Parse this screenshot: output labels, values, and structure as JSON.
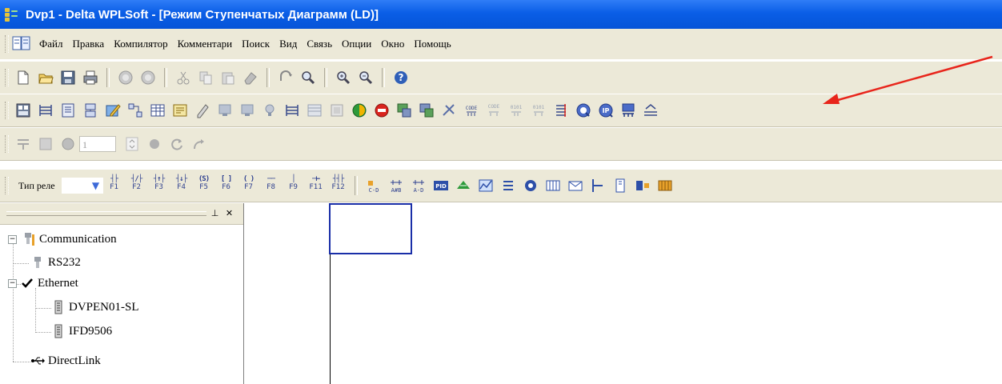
{
  "window": {
    "title": "Dvp1 - Delta WPLSoft - [Режим Ступенчатых Диаграмм (LD)]"
  },
  "menu": {
    "items": [
      "Файл",
      "Правка",
      "Компилятор",
      "Комментари",
      "Поиск",
      "Вид",
      "Связь",
      "Опции",
      "Окно",
      "Помощь"
    ]
  },
  "toolbar_input": {
    "relay_type_label": "Тип реле",
    "step_value": "1"
  },
  "function_keys": [
    {
      "icon": "contact-no-icon",
      "key": "F1"
    },
    {
      "icon": "contact-nc-icon",
      "key": "F2"
    },
    {
      "icon": "contact-rising-icon",
      "key": "F3"
    },
    {
      "icon": "contact-falling-icon",
      "key": "F4"
    },
    {
      "icon": "coil-set-icon",
      "key": "F5"
    },
    {
      "icon": "application-instruction-icon",
      "key": "F6"
    },
    {
      "icon": "output-coil-icon",
      "key": "F7"
    },
    {
      "icon": "horizontal-line-icon",
      "key": "F8"
    },
    {
      "icon": "vertical-line-icon",
      "key": "F9"
    },
    {
      "icon": "invert-icon",
      "key": "F11"
    },
    {
      "icon": "parallel-branch-icon",
      "key": "F12"
    }
  ],
  "tree": {
    "root": "Communication",
    "items": {
      "rs232": "RS232",
      "ethernet": "Ethernet",
      "dvpen01": "DVPEN01-SL",
      "ifd9506": "IFD9506",
      "directlink": "DirectLink"
    }
  },
  "colors": {
    "titlebar": "#0a5ee6",
    "chrome": "#ece9d8",
    "annotation_arrow": "#e8251b",
    "ladder_cursor": "#1a2fa8"
  }
}
